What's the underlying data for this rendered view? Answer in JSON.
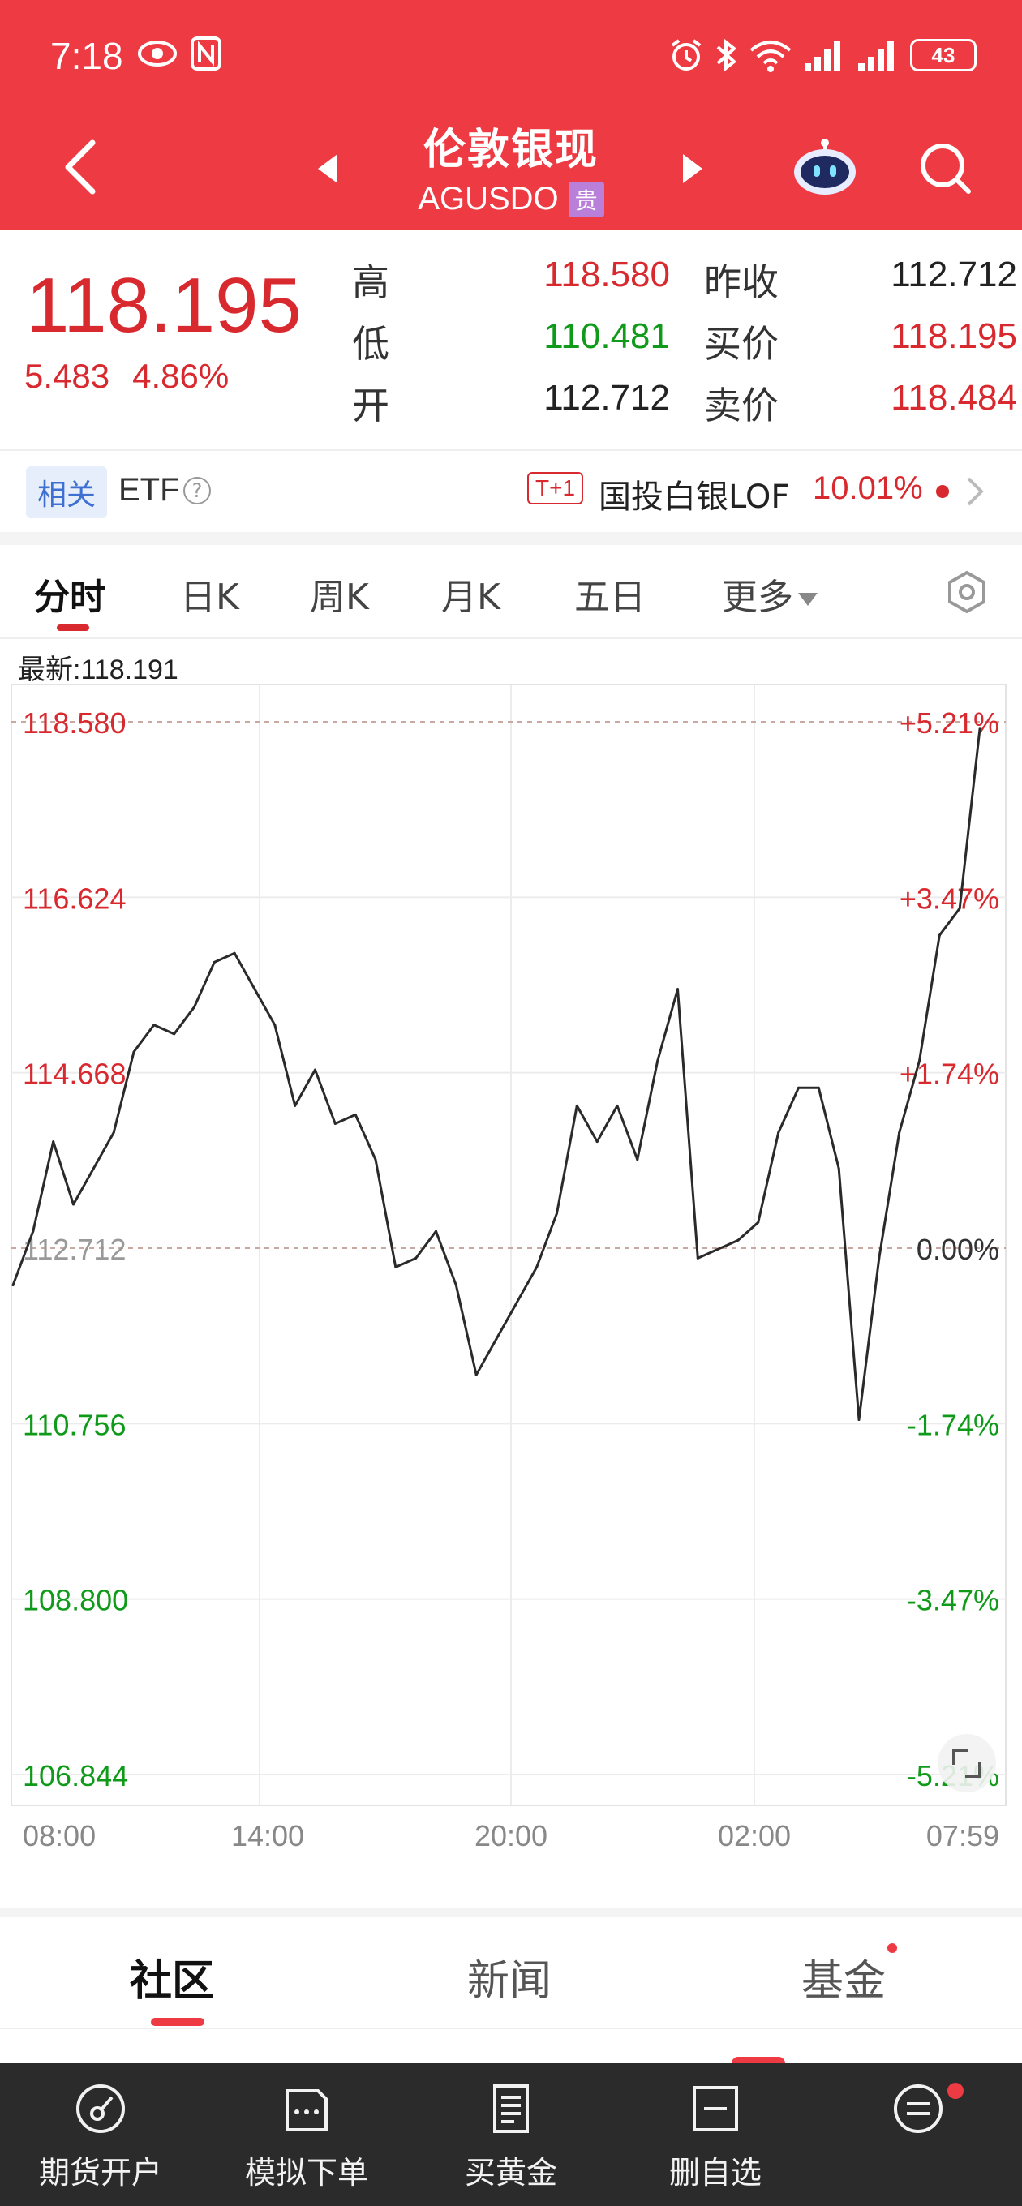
{
  "status_bar": {
    "time": "7:18",
    "battery": "43"
  },
  "header": {
    "title": "伦敦银现",
    "subtitle": "AGUSDO",
    "badge": "贵"
  },
  "quote": {
    "price": "118.195",
    "change": "5.483",
    "change_pct": "4.86%",
    "high_label": "高",
    "high": "118.580",
    "low_label": "低",
    "low": "110.481",
    "open_label": "开",
    "open": "112.712",
    "prev_close_label": "昨收",
    "prev_close": "112.712",
    "bid_label": "买价",
    "bid": "118.195",
    "ask_label": "卖价",
    "ask": "118.484"
  },
  "related": {
    "tag": "相关",
    "etf_label": "ETF",
    "help": "?",
    "t1_badge": "T+1",
    "fund_name": "国投白银LOF",
    "fund_pct": "10.01%"
  },
  "chart_tabs": [
    {
      "label": "分时",
      "active": true
    },
    {
      "label": "日K"
    },
    {
      "label": "周K"
    },
    {
      "label": "月K"
    },
    {
      "label": "五日"
    },
    {
      "label": "更多"
    }
  ],
  "latest_label": "最新:118.191",
  "chart_data": {
    "type": "line",
    "title": "",
    "xlabel": "",
    "ylabel": "",
    "x_ticks": [
      "08:00",
      "14:00",
      "20:00",
      "02:00",
      "07:59"
    ],
    "y_ticks": [
      "118.580",
      "116.624",
      "114.668",
      "112.712",
      "110.756",
      "108.800",
      "106.844"
    ],
    "y_tick_values": [
      118.58,
      116.624,
      114.668,
      112.712,
      110.756,
      108.8,
      106.844
    ],
    "pct_ticks": [
      "+5.21%",
      "+3.47%",
      "+1.74%",
      "0.00%",
      "-1.74%",
      "-3.47%",
      "-5.21%"
    ],
    "ylim": [
      106.844,
      118.58
    ],
    "reference": 112.712,
    "grid": true,
    "series": [
      {
        "x": [
          "08:00",
          "08:30",
          "09:00",
          "09:30",
          "10:00",
          "10:30",
          "11:00",
          "11:30",
          "12:00",
          "12:30",
          "13:00",
          "13:30",
          "14:00",
          "14:30",
          "15:00",
          "15:30",
          "16:00",
          "16:30",
          "17:00",
          "17:30",
          "18:00",
          "18:30",
          "19:00",
          "19:30",
          "20:00",
          "20:30",
          "21:00",
          "21:30",
          "22:00",
          "22:30",
          "23:00",
          "23:30",
          "00:00",
          "00:30",
          "01:00",
          "01:30",
          "02:00",
          "02:30",
          "03:00",
          "03:30",
          "04:00",
          "04:30",
          "05:00",
          "05:30",
          "06:00",
          "06:30",
          "07:00",
          "07:30",
          "07:59"
        ],
        "values": [
          112.3,
          112.9,
          113.9,
          113.2,
          113.6,
          114.0,
          114.9,
          115.2,
          115.1,
          115.4,
          115.9,
          116.0,
          115.6,
          115.2,
          114.3,
          114.7,
          114.1,
          114.2,
          113.7,
          112.5,
          112.6,
          112.9,
          112.3,
          111.3,
          111.7,
          112.1,
          112.5,
          113.1,
          114.3,
          113.9,
          114.3,
          113.7,
          114.8,
          115.6,
          112.6,
          112.7,
          112.8,
          113.0,
          114.0,
          114.5,
          114.5,
          113.6,
          110.8,
          112.6,
          114.0,
          114.8,
          116.2,
          116.5,
          118.5
        ]
      }
    ]
  },
  "community_tabs": [
    "社区",
    "新闻",
    "基金"
  ],
  "bottom_nav": [
    "期货开户",
    "模拟下单",
    "买黄金",
    "删自选",
    "更多"
  ]
}
